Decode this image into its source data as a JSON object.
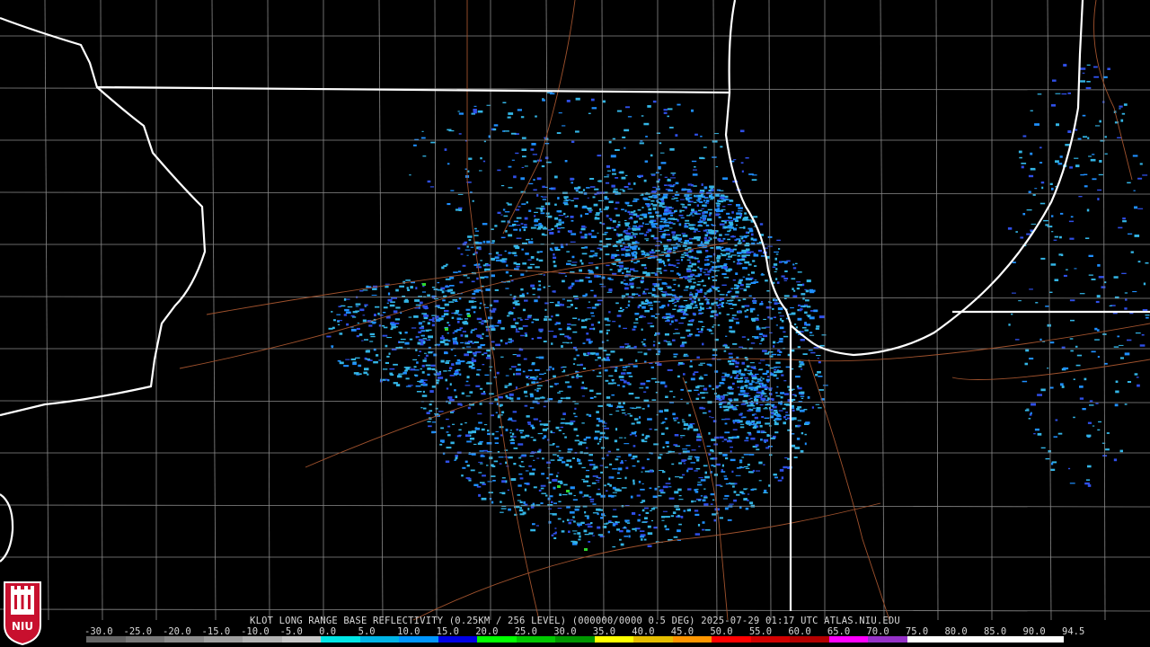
{
  "product_caption": "KLOT LONG RANGE BASE REFLECTIVITY (0.25KM / 256 LEVEL) (000000/0000 0.5 DEG) 2025-07-29 01:17 UTC  ATLAS.NIU.EDU",
  "logo_text": "NIU",
  "color_scale": {
    "labels": [
      "-30.0",
      "-25.0",
      "-20.0",
      "-15.0",
      "-10.0",
      "-5.0",
      "0.0",
      "5.0",
      "10.0",
      "15.0",
      "20.0",
      "25.0",
      "30.0",
      "35.0",
      "40.0",
      "45.0",
      "50.0",
      "55.0",
      "60.0",
      "65.0",
      "70.0",
      "75.0",
      "80.0",
      "85.0",
      "90.0",
      "94.5"
    ],
    "colors": [
      "#646464",
      "#787878",
      "#8c8c8c",
      "#a0a0a0",
      "#b4b4b4",
      "#c8c8c8",
      "#00e6e6",
      "#00b4e6",
      "#0096ff",
      "#0000e6",
      "#00ff00",
      "#00c800",
      "#009600",
      "#ffff00",
      "#e6be00",
      "#ff9600",
      "#ff0000",
      "#d20000",
      "#b40000",
      "#ff00ff",
      "#9632c8",
      "#ffffff",
      "#ffffff",
      "#ffffff",
      "#ffffff"
    ]
  },
  "colors": {
    "state_border": "#ffffff",
    "county_border": "#8a8a8a",
    "highway": "#a0522d",
    "echo_light": "#33b5e5",
    "echo_mid": "#1f8fff",
    "echo_deep": "#2f4fe8",
    "echo_green": "#2fd62f"
  }
}
